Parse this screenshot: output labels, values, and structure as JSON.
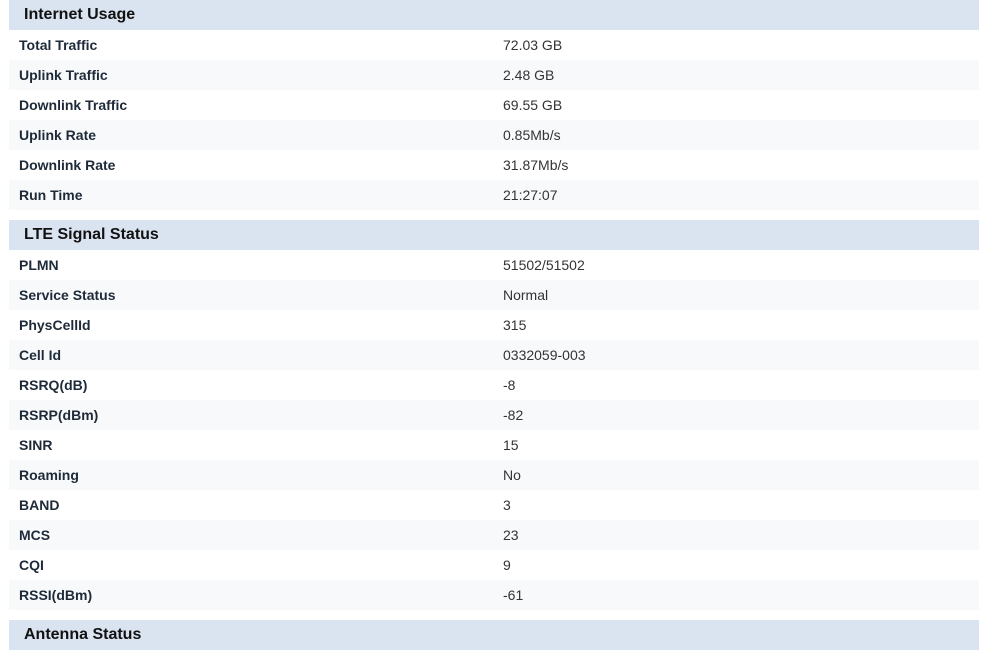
{
  "sections": [
    {
      "title": "Internet Usage",
      "rows": [
        {
          "label": "Total Traffic",
          "value": "72.03 GB"
        },
        {
          "label": "Uplink Traffic",
          "value": "2.48 GB"
        },
        {
          "label": "Downlink Traffic",
          "value": "69.55 GB"
        },
        {
          "label": "Uplink Rate",
          "value": "0.85Mb/s"
        },
        {
          "label": "Downlink Rate",
          "value": "31.87Mb/s"
        },
        {
          "label": "Run Time",
          "value": "21:27:07"
        }
      ]
    },
    {
      "title": "LTE Signal Status",
      "rows": [
        {
          "label": "PLMN",
          "value": "51502/51502"
        },
        {
          "label": "Service Status",
          "value": "Normal"
        },
        {
          "label": "PhysCellId",
          "value": "315"
        },
        {
          "label": "Cell Id",
          "value": "0332059-003"
        },
        {
          "label": "RSRQ(dB)",
          "value": "-8"
        },
        {
          "label": "RSRP(dBm)",
          "value": "-82"
        },
        {
          "label": "SINR",
          "value": "15"
        },
        {
          "label": "Roaming",
          "value": "No"
        },
        {
          "label": "BAND",
          "value": "3"
        },
        {
          "label": "MCS",
          "value": "23"
        },
        {
          "label": "CQI",
          "value": "9"
        },
        {
          "label": "RSSI(dBm)",
          "value": "-61"
        }
      ]
    },
    {
      "title": "Antenna Status",
      "rows": []
    }
  ],
  "colors": {
    "header_bg": "#dae3f0",
    "row_alt_bg": "#f7f9fb"
  }
}
